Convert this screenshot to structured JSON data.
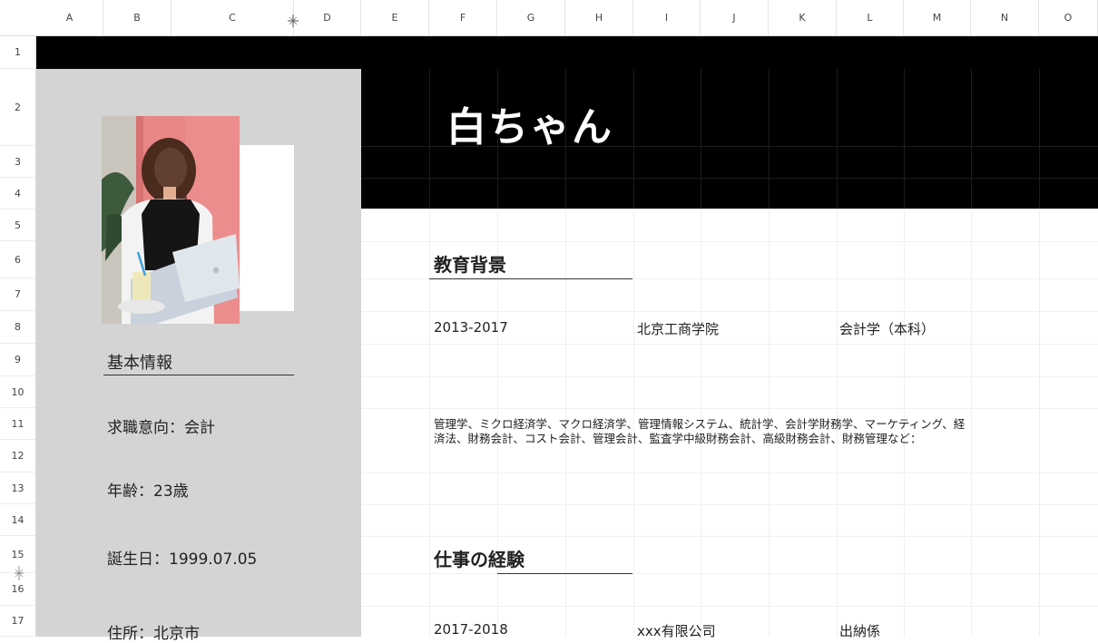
{
  "columns": [
    "A",
    "B",
    "C",
    "D",
    "E",
    "F",
    "G",
    "H",
    "I",
    "J",
    "K",
    "L",
    "M",
    "N",
    "O"
  ],
  "rows": [
    "1",
    "2",
    "3",
    "4",
    "5",
    "6",
    "7",
    "8",
    "9",
    "10",
    "11",
    "12",
    "13",
    "14",
    "15",
    "16",
    "17"
  ],
  "title": "白ちゃん",
  "sidebar": {
    "section_title": "基本情報",
    "job_intention": "求職意向：会計",
    "age": "年齢：23歳",
    "birthday": "誕生日：1999.07.05",
    "address": "住所：北京市"
  },
  "education": {
    "section_title": "教育背景",
    "period": "2013-2017",
    "school": "北京工商学院",
    "major": "会計学（本科）",
    "courses": "管理学、ミクロ経済学、マクロ経済学、管理情報システム、統計学、会計学財務学、マーケティング、経済法、財務会計、コスト会計、管理会計、監査学中級財務会計、高級財務会計、財務管理など："
  },
  "work": {
    "section_title": "仕事の経験",
    "period": "2017-2018",
    "company": "xxx有限公司",
    "position": "出納係"
  },
  "colors": {
    "black_block": "#000000",
    "sidebar_bg": "#d4d4d4",
    "photo_wall": "#e98686"
  },
  "icons": {
    "corner": "eye-icon",
    "column_resize": "resize-icon"
  }
}
